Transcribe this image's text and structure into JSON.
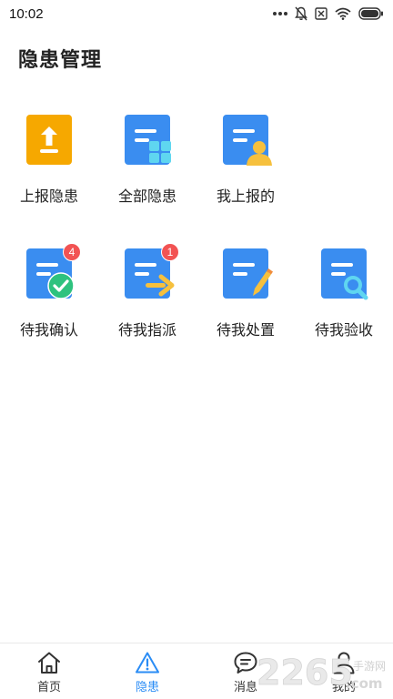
{
  "status_bar": {
    "time": "10:02",
    "icons": [
      "more-dots-icon",
      "mute-bell-icon",
      "sim-off-icon",
      "wifi-icon",
      "battery-icon"
    ]
  },
  "page": {
    "title": "隐患管理"
  },
  "grid": {
    "row1": [
      {
        "label": "上报隐患",
        "icon": "upload-icon",
        "color": "#f6a800"
      },
      {
        "label": "全部隐患",
        "icon": "all-hazards-icon",
        "color": "#3a8df0"
      },
      {
        "label": "我上报的",
        "icon": "my-reports-icon",
        "color": "#3a8df0"
      }
    ],
    "row2": [
      {
        "label": "待我确认",
        "icon": "confirm-icon",
        "badge": "4",
        "color": "#3a8df0"
      },
      {
        "label": "待我指派",
        "icon": "assign-icon",
        "badge": "1",
        "color": "#3a8df0"
      },
      {
        "label": "待我处置",
        "icon": "handle-icon",
        "color": "#3a8df0"
      },
      {
        "label": "待我验收",
        "icon": "inspect-icon",
        "color": "#3a8df0"
      }
    ]
  },
  "bottom_nav": {
    "items": [
      {
        "label": "首页",
        "icon": "home-icon"
      },
      {
        "label": "隐患",
        "icon": "warning-icon",
        "active": true
      },
      {
        "label": "消息",
        "icon": "message-icon"
      },
      {
        "label": "我的",
        "icon": "user-icon"
      }
    ],
    "active_color": "#2a8cf5"
  },
  "watermark": {
    "text": "2265",
    "suffix": ".com",
    "tag": "手游网"
  }
}
